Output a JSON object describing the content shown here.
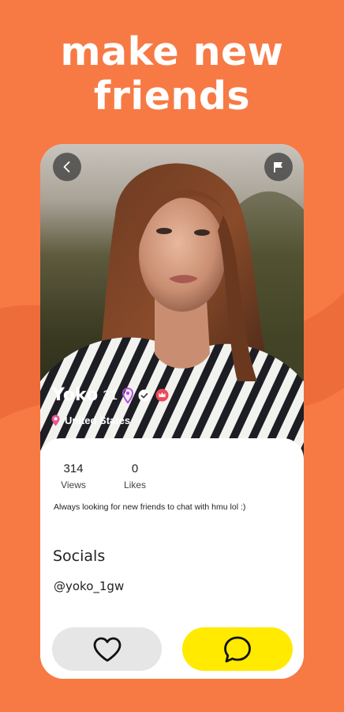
{
  "headline": {
    "line1": "make new",
    "line2": "friends"
  },
  "colors": {
    "background": "#F77A45",
    "chat_button": "#FFEA00",
    "like_button": "#E6E6E6",
    "location_pin": "#E8578F",
    "premium_badge": "#F0485A"
  },
  "profile": {
    "name": "Yoko",
    "age": "31",
    "location": "United States",
    "badges": [
      "pin-icon",
      "verified-icon",
      "premium-badge-icon"
    ]
  },
  "stats": {
    "views_count": "314",
    "views_label": "Views",
    "likes_count": "0",
    "likes_label": "Likes"
  },
  "bio": "Always looking for new friends to chat with hmu lol :)",
  "socials": {
    "title": "Socials",
    "handle": "@yoko_1gw"
  },
  "actions": {
    "like_icon": "heart-icon",
    "chat_icon": "chat-bubble-icon",
    "back_icon": "chevron-left-icon",
    "flag_icon": "flag-icon"
  }
}
